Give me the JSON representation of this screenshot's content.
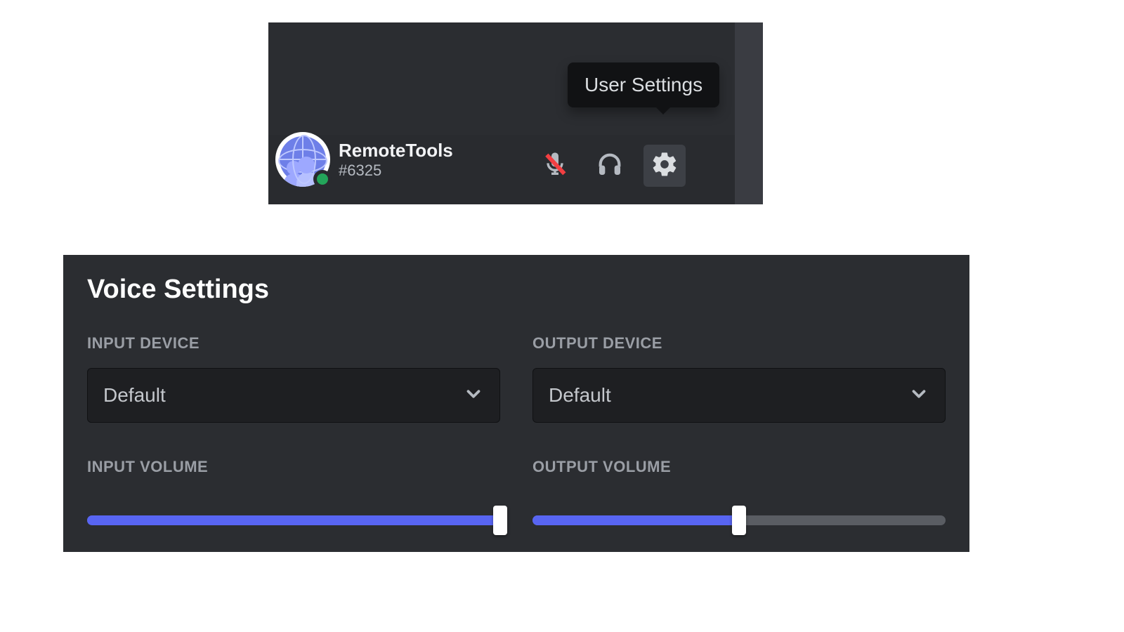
{
  "top": {
    "tooltip": "User Settings",
    "username": "RemoteTools",
    "discriminator": "#6325",
    "status": "online"
  },
  "settings": {
    "title": "Voice Settings",
    "input_device": {
      "label": "INPUT DEVICE",
      "value": "Default"
    },
    "output_device": {
      "label": "OUTPUT DEVICE",
      "value": "Default"
    },
    "input_volume": {
      "label": "INPUT VOLUME",
      "percent": 100
    },
    "output_volume": {
      "label": "OUTPUT VOLUME",
      "percent": 50
    }
  },
  "colors": {
    "accent": "#5865f2",
    "online": "#23a55a",
    "danger": "#f23f42",
    "bg_panel": "#2b2d31",
    "bg_darker": "#1e1f22"
  }
}
